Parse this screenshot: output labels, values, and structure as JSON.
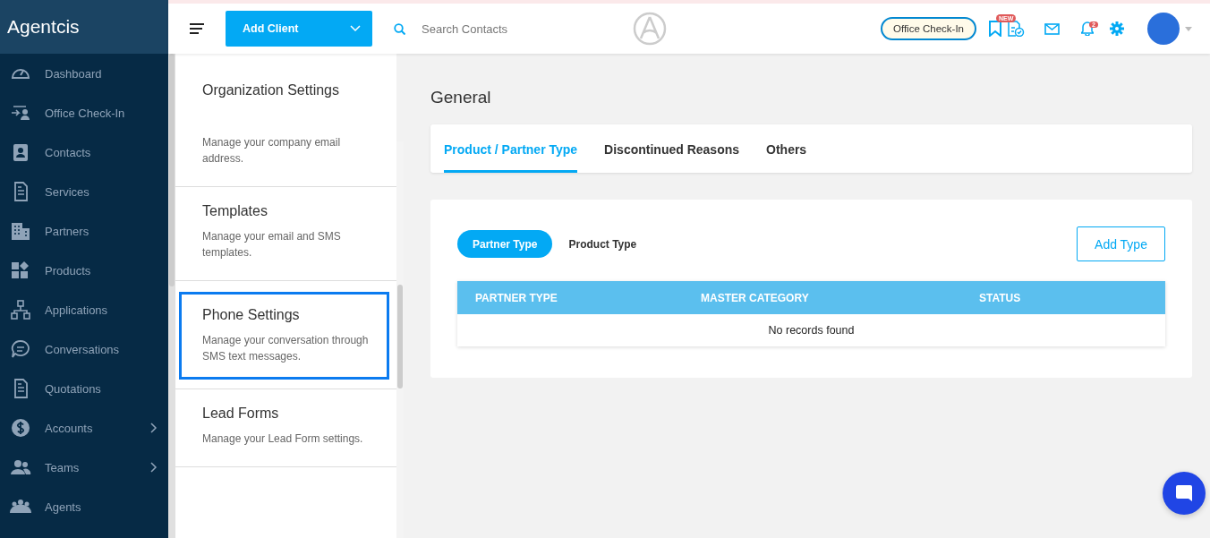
{
  "sidebar": {
    "brand": "Agentcis",
    "items": [
      {
        "label": "Dashboard",
        "has_submenu": false
      },
      {
        "label": "Office Check-In",
        "has_submenu": false
      },
      {
        "label": "Contacts",
        "has_submenu": false
      },
      {
        "label": "Services",
        "has_submenu": false
      },
      {
        "label": "Partners",
        "has_submenu": false
      },
      {
        "label": "Products",
        "has_submenu": false
      },
      {
        "label": "Applications",
        "has_submenu": false
      },
      {
        "label": "Conversations",
        "has_submenu": false
      },
      {
        "label": "Quotations",
        "has_submenu": false
      },
      {
        "label": "Accounts",
        "has_submenu": true
      },
      {
        "label": "Teams",
        "has_submenu": true
      },
      {
        "label": "Agents",
        "has_submenu": false
      }
    ]
  },
  "topbar": {
    "add_button": "Add Client",
    "search": {
      "placeholder": "Search Contacts"
    },
    "office_checkin": "Office Check-In",
    "new_badge": "NEW",
    "notification_count": "2"
  },
  "settings": {
    "items": [
      {
        "title": "Organization Settings",
        "description": "Manage your company email address.",
        "selected": false
      },
      {
        "title": "Templates",
        "description": "Manage your email and SMS templates.",
        "selected": false
      },
      {
        "title": "Phone Settings",
        "description": "Manage your conversation through SMS text messages.",
        "selected": true
      },
      {
        "title": "Lead Forms",
        "description": "Manage your Lead Form settings.",
        "selected": false
      }
    ]
  },
  "page_title": "General",
  "tabs": [
    {
      "label": "Product / Partner Type",
      "selected": true
    },
    {
      "label": "Discontinued Reasons",
      "selected": false
    },
    {
      "label": "Others",
      "selected": false
    }
  ],
  "type_toggle": [
    {
      "label": "Partner Type",
      "selected": true
    },
    {
      "label": "Product Type",
      "selected": false
    }
  ],
  "add_type_button": "Add Type",
  "table": {
    "columns": [
      "PARTNER TYPE",
      "MASTER CATEGORY",
      "STATUS"
    ],
    "empty_message": "No records found"
  }
}
